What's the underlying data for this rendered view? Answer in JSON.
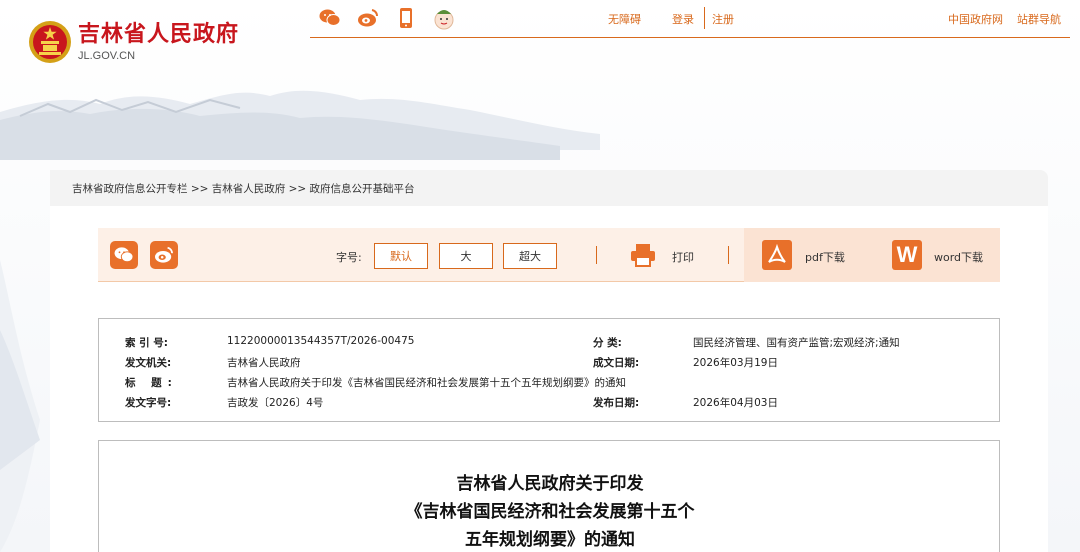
{
  "header": {
    "site_name": "吉林省人民政府",
    "site_domain": "JL.GOV.CN",
    "social_icons": [
      "wechat-icon",
      "weibo-icon",
      "mobile-icon",
      "mascot-icon"
    ],
    "links": {
      "accessibility": "无障碍",
      "login": "登录",
      "register": "注册",
      "gov_portal": "中国政府网",
      "site_nav": "站群导航"
    },
    "accent_color": "#d8691c",
    "brand_color": "#c8161d"
  },
  "breadcrumb": "吉林省政府信息公开专栏 >> 吉林省人民政府 >> 政府信息公开基础平台",
  "toolbar": {
    "share_icons": [
      "wechat-icon",
      "weibo-icon"
    ],
    "font_size_label": "字号:",
    "font_sizes": [
      "默认",
      "大",
      "超大"
    ],
    "print_label": "打印",
    "pdf_label": "pdf下载",
    "word_label": "word下载"
  },
  "meta": {
    "index_no_label": "索 引 号:",
    "index_no": "11220000013544357T/2026-00475",
    "category_label": "分 类:",
    "category": "国民经济管理、国有资产监管;宏观经济;通知",
    "issuer_label": "发文机关:",
    "issuer": "吉林省人民政府",
    "written_date_label": "成文日期:",
    "written_date": "2026年03月19日",
    "title_label": "标 题:",
    "title": "吉林省人民政府关于印发《吉林省国民经济和社会发展第十五个五年规划纲要》的通知",
    "doc_no_label": "发文字号:",
    "doc_no": "吉政发〔2026〕4号",
    "publish_date_label": "发布日期:",
    "publish_date": "2026年04月03日"
  },
  "document": {
    "title_lines": [
      "吉林省人民政府关于印发",
      "《吉林省国民经济和社会发展第十五个",
      "五年规划纲要》的通知"
    ]
  }
}
